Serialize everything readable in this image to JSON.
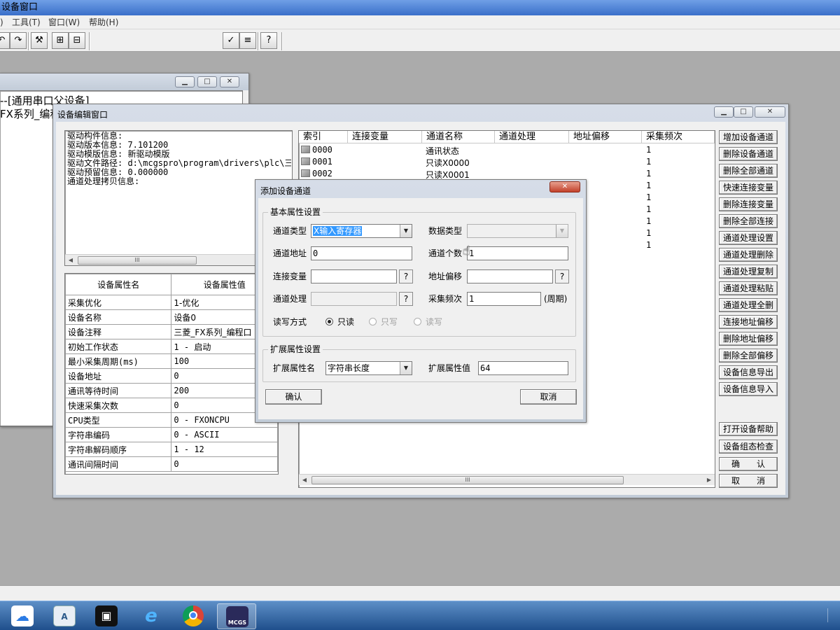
{
  "app": {
    "title": "设备窗口",
    "menus": [
      "工具(T)",
      "窗口(W)",
      "帮助(H)"
    ]
  },
  "bg_window": {
    "line1": "--[通用串口父设备]",
    "line2": "FX系列_编程"
  },
  "editor": {
    "title": "设备编辑窗口",
    "info_lines": [
      "驱动构件信息:",
      "驱动版本信息: 7.101200",
      "驱动模版信息: 新驱动模版",
      "驱动文件路径: d:\\mcgspro\\program\\drivers\\plc\\三",
      "驱动预留信息: 0.000000",
      "通道处理拷贝信息:"
    ],
    "prop_headers": [
      "设备属性名",
      "设备属性值"
    ],
    "props": [
      [
        "采集优化",
        "1-优化"
      ],
      [
        "设备名称",
        "设备0"
      ],
      [
        "设备注释",
        "三菱_FX系列_编程口"
      ],
      [
        "初始工作状态",
        "1 - 启动"
      ],
      [
        "最小采集周期(ms)",
        "100"
      ],
      [
        "设备地址",
        "0"
      ],
      [
        "通讯等待时间",
        "200"
      ],
      [
        "快速采集次数",
        "0"
      ],
      [
        "CPU类型",
        "0 - FXONCPU"
      ],
      [
        "字符串编码",
        "0 - ASCII"
      ],
      [
        "字符串解码顺序",
        "1 - 12"
      ],
      [
        "通讯间隔时间",
        "0"
      ]
    ],
    "list_headers": [
      "索引",
      "连接变量",
      "通道名称",
      "通道处理",
      "地址偏移",
      "采集频次"
    ],
    "list_rows": [
      [
        "0000",
        "通讯状态",
        "1"
      ],
      [
        "0001",
        "只读X0000",
        "1"
      ],
      [
        "0002",
        "只读X0001",
        "1"
      ]
    ],
    "extra_freq": [
      "1",
      "1",
      "1",
      "1",
      "1",
      "1"
    ],
    "buttons": [
      "增加设备通道",
      "删除设备通道",
      "删除全部通道",
      "快速连接变量",
      "删除连接变量",
      "删除全部连接",
      "通道处理设置",
      "通道处理删除",
      "通道处理复制",
      "通道处理粘贴",
      "通道处理全删",
      "连接地址偏移",
      "删除地址偏移",
      "删除全部偏移",
      "设备信息导出",
      "设备信息导入"
    ],
    "bottom_buttons": [
      "打开设备帮助",
      "设备组态检查",
      "确　　认",
      "取　　消"
    ],
    "scroll_glyph": "III"
  },
  "dialog": {
    "title": "添加设备通道",
    "basic_group": "基本属性设置",
    "channel_type_label": "通道类型",
    "channel_type_value": "X输入寄存器",
    "data_type_label": "数据类型",
    "data_type_value": "",
    "address_label": "通道地址",
    "address_value": "0",
    "count_label": "通道个数",
    "count_value": "1",
    "link_label": "连接变量",
    "link_value": "",
    "offset_label": "地址偏移",
    "offset_value": "",
    "process_label": "通道处理",
    "process_value": "",
    "freq_label": "采集频次",
    "freq_value": "1",
    "freq_unit": "(周期)",
    "rw_label": "读写方式",
    "rw_options": [
      "只读",
      "只写",
      "读写"
    ],
    "q": "?",
    "ext_group": "扩展属性设置",
    "ext_name_label": "扩展属性名",
    "ext_name_value": "字符串长度",
    "ext_value_label": "扩展属性值",
    "ext_value_value": "64",
    "ok": "确认",
    "cancel": "取消",
    "close": "✕"
  },
  "taskbar": {
    "mcgs_label": "MCGS"
  },
  "colors": {
    "accent": "#3399ff",
    "close_red": "#c2412a",
    "selection": "#3399ff"
  }
}
